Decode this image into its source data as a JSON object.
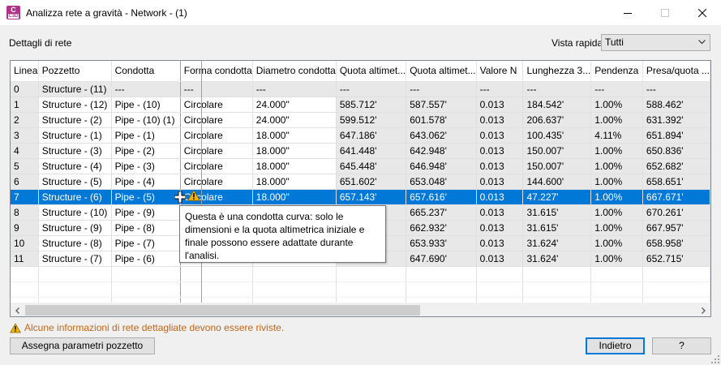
{
  "window": {
    "title": "Analizza rete a gravità - Network - (1)",
    "app_icon_letter": "C",
    "app_icon_sub": "C3D"
  },
  "labels": {
    "details": "Dettagli di rete",
    "quick_view": "Vista rapida"
  },
  "quick_view_select": {
    "value": "Tutti"
  },
  "grid": {
    "columns": [
      "Linea",
      "Pozzetto",
      "Condotta",
      "Forma condotta",
      "Diametro condotta",
      "Quota altimet...",
      "Quota altimet...",
      "Valore N",
      "Lunghezza 3...",
      "Pendenza",
      "Presa/quota ..."
    ],
    "rows": [
      [
        "0",
        "Structure - (11)",
        "---",
        "---",
        "---",
        "---",
        "---",
        "---",
        "---",
        "---",
        "---"
      ],
      [
        "1",
        "Structure - (12)",
        "Pipe - (10)",
        "Circolare",
        "24.000\"",
        "585.712'",
        "587.557'",
        "0.013",
        "184.542'",
        "1.00%",
        "588.462'"
      ],
      [
        "2",
        "Structure - (2)",
        "Pipe - (10) (1)",
        "Circolare",
        "24.000\"",
        "599.512'",
        "601.578'",
        "0.013",
        "206.637'",
        "1.00%",
        "631.392'"
      ],
      [
        "3",
        "Structure - (1)",
        "Pipe - (1)",
        "Circolare",
        "18.000\"",
        "647.186'",
        "643.062'",
        "0.013",
        "100.435'",
        "4.11%",
        "651.894'"
      ],
      [
        "4",
        "Structure - (3)",
        "Pipe - (2)",
        "Circolare",
        "18.000\"",
        "641.448'",
        "642.948'",
        "0.013",
        "150.007'",
        "1.00%",
        "650.836'"
      ],
      [
        "5",
        "Structure - (4)",
        "Pipe - (3)",
        "Circolare",
        "18.000\"",
        "645.448'",
        "646.948'",
        "0.013",
        "150.007'",
        "1.00%",
        "652.682'"
      ],
      [
        "6",
        "Structure - (5)",
        "Pipe - (4)",
        "Circolare",
        "18.000\"",
        "651.602'",
        "653.048'",
        "0.013",
        "144.600'",
        "1.00%",
        "658.651'"
      ],
      [
        "7",
        "Structure - (6)",
        "Pipe - (5)",
        "Circolare",
        "18.000\"",
        "657.143'",
        "657.616'",
        "0.013",
        "47.227'",
        "1.00%",
        "667.671'"
      ],
      [
        "8",
        "Structure - (10)",
        "Pipe - (9)",
        "",
        "",
        "",
        "665.237'",
        "0.013",
        "31.615'",
        "1.00%",
        "670.261'"
      ],
      [
        "9",
        "Structure - (9)",
        "Pipe - (8)",
        "",
        "",
        "",
        "662.932'",
        "0.013",
        "31.615'",
        "1.00%",
        "667.957'"
      ],
      [
        "10",
        "Structure - (8)",
        "Pipe - (7)",
        "",
        "",
        "",
        "653.933'",
        "0.013",
        "31.624'",
        "1.00%",
        "658.958'"
      ],
      [
        "11",
        "Structure - (7)",
        "Pipe - (6)",
        "",
        "",
        "",
        "647.690'",
        "0.013",
        "31.624'",
        "1.00%",
        "652.715'"
      ]
    ],
    "selected_row": 7
  },
  "tooltip": {
    "text": "Questa è una condotta curva: solo le dimensioni e la quota altimetrica iniziale e finale possono essere adattate durante l'analisi."
  },
  "footer": {
    "warning": "Alcune informazioni di rete dettagliate devono essere riviste.",
    "assign_button": "Assegna parametri pozzetto",
    "back_button": "Indietro",
    "help_button": "?"
  },
  "colors": {
    "selection": "#0078d7",
    "warning_text": "#c0661a",
    "warning_icon": "#f0b400",
    "readonly_cell": "#e8e8e8",
    "app_icon": "#b0338a"
  }
}
